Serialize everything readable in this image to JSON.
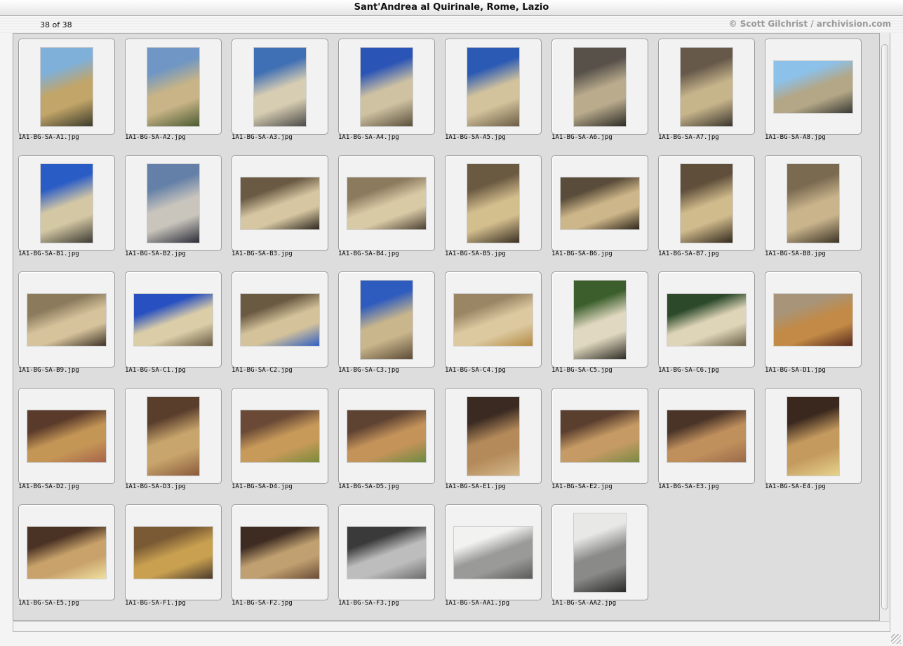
{
  "window": {
    "title": "Sant'Andrea al Quirinale, Rome, Lazio"
  },
  "status": {
    "count": "38 of 38",
    "credit": "© Scott Gilchrist / archivision.com"
  },
  "slides": [
    {
      "file": "1A1-BG-SA-A1.jpg",
      "orientation": "portrait",
      "colors": [
        "#7fb0da",
        "#c2a568",
        "#3b3b2c"
      ]
    },
    {
      "file": "1A1-BG-SA-A2.jpg",
      "orientation": "portrait",
      "colors": [
        "#6f96c4",
        "#c8b486",
        "#4b5a32"
      ]
    },
    {
      "file": "1A1-BG-SA-A3.jpg",
      "orientation": "portrait",
      "colors": [
        "#3f6fb4",
        "#d7cdb2",
        "#4a4a48"
      ]
    },
    {
      "file": "1A1-BG-SA-A4.jpg",
      "orientation": "portrait",
      "colors": [
        "#2a54b6",
        "#cfc2a2",
        "#5a4f3c"
      ]
    },
    {
      "file": "1A1-BG-SA-A5.jpg",
      "orientation": "portrait",
      "colors": [
        "#2b5ab4",
        "#d2c39c",
        "#6b5c44"
      ]
    },
    {
      "file": "1A1-BG-SA-A6.jpg",
      "orientation": "portrait",
      "colors": [
        "#57514a",
        "#b9ab8c",
        "#2d2b26"
      ]
    },
    {
      "file": "1A1-BG-SA-A7.jpg",
      "orientation": "portrait",
      "colors": [
        "#66594a",
        "#c6b48b",
        "#3b352c"
      ]
    },
    {
      "file": "1A1-BG-SA-A8.jpg",
      "orientation": "landscape",
      "colors": [
        "#8cc1ea",
        "#b3a787",
        "#3a3a34"
      ]
    },
    {
      "file": "1A1-BG-SA-B1.jpg",
      "orientation": "portrait",
      "colors": [
        "#2a5cc6",
        "#d4c8a4",
        "#3c3a32"
      ]
    },
    {
      "file": "1A1-BG-SA-B2.jpg",
      "orientation": "portrait",
      "colors": [
        "#6480a8",
        "#c9c5bc",
        "#2a2c38"
      ]
    },
    {
      "file": "1A1-BG-SA-B3.jpg",
      "orientation": "landscape",
      "colors": [
        "#6a5a44",
        "#d6c7a2",
        "#2c261e"
      ]
    },
    {
      "file": "1A1-BG-SA-B4.jpg",
      "orientation": "landscape",
      "colors": [
        "#8c7a5e",
        "#d9caa6",
        "#4b4032"
      ]
    },
    {
      "file": "1A1-BG-SA-B5.jpg",
      "orientation": "portrait",
      "colors": [
        "#6b5a42",
        "#d3be8e",
        "#3a3024"
      ]
    },
    {
      "file": "1A1-BG-SA-B6.jpg",
      "orientation": "landscape",
      "colors": [
        "#5a4c3a",
        "#cdb689",
        "#2e261c"
      ]
    },
    {
      "file": "1A1-BG-SA-B7.jpg",
      "orientation": "portrait",
      "colors": [
        "#5e4e3a",
        "#d0bb8c",
        "#33291e"
      ]
    },
    {
      "file": "1A1-BG-SA-B8.jpg",
      "orientation": "portrait",
      "colors": [
        "#7a6a50",
        "#c9b48c",
        "#3d3426"
      ]
    },
    {
      "file": "1A1-BG-SA-B9.jpg",
      "orientation": "landscape",
      "colors": [
        "#8b7a5c",
        "#d6c39c",
        "#3d3327"
      ]
    },
    {
      "file": "1A1-BG-SA-C1.jpg",
      "orientation": "landscape",
      "colors": [
        "#2850c0",
        "#dacda8",
        "#6a5c44"
      ]
    },
    {
      "file": "1A1-BG-SA-C2.jpg",
      "orientation": "landscape",
      "colors": [
        "#6a5a42",
        "#d4c29a",
        "#2f5fc2"
      ]
    },
    {
      "file": "1A1-BG-SA-C3.jpg",
      "orientation": "portrait",
      "colors": [
        "#2e5cbe",
        "#c9b68c",
        "#5c4c36"
      ]
    },
    {
      "file": "1A1-BG-SA-C4.jpg",
      "orientation": "landscape",
      "colors": [
        "#9a8664",
        "#dcc9a0",
        "#b48a44"
      ]
    },
    {
      "file": "1A1-BG-SA-C5.jpg",
      "orientation": "portrait",
      "colors": [
        "#3b5e2c",
        "#e0d8c0",
        "#2e2c24"
      ]
    },
    {
      "file": "1A1-BG-SA-C6.jpg",
      "orientation": "landscape",
      "colors": [
        "#2c4a2a",
        "#ded4b8",
        "#6a6048"
      ]
    },
    {
      "file": "1A1-BG-SA-D1.jpg",
      "orientation": "landscape",
      "colors": [
        "#a89478",
        "#c28a46",
        "#5a2a1e"
      ]
    },
    {
      "file": "1A1-BG-SA-D2.jpg",
      "orientation": "landscape",
      "colors": [
        "#5a3a2a",
        "#c49656",
        "#a8644a"
      ]
    },
    {
      "file": "1A1-BG-SA-D3.jpg",
      "orientation": "portrait",
      "colors": [
        "#5a3e2c",
        "#c8a56c",
        "#8a5a3c"
      ]
    },
    {
      "file": "1A1-BG-SA-D4.jpg",
      "orientation": "landscape",
      "colors": [
        "#6a4a36",
        "#c89a5a",
        "#7a8a3a"
      ]
    },
    {
      "file": "1A1-BG-SA-D5.jpg",
      "orientation": "landscape",
      "colors": [
        "#5e4232",
        "#c4935a",
        "#6c8a40"
      ]
    },
    {
      "file": "1A1-BG-SA-E1.jpg",
      "orientation": "portrait",
      "colors": [
        "#3a2a22",
        "#b48a5a",
        "#d4b88a"
      ]
    },
    {
      "file": "1A1-BG-SA-E2.jpg",
      "orientation": "landscape",
      "colors": [
        "#5a3e2e",
        "#c59a64",
        "#7a8a44"
      ]
    },
    {
      "file": "1A1-BG-SA-E3.jpg",
      "orientation": "landscape",
      "colors": [
        "#4a3428",
        "#bf8f5c",
        "#9a6a4a"
      ]
    },
    {
      "file": "1A1-BG-SA-E4.jpg",
      "orientation": "portrait",
      "colors": [
        "#3a281e",
        "#c49a5e",
        "#e6d38c"
      ]
    },
    {
      "file": "1A1-BG-SA-E5.jpg",
      "orientation": "landscape",
      "colors": [
        "#4a3224",
        "#c8a26a",
        "#f0e0a0"
      ]
    },
    {
      "file": "1A1-BG-SA-F1.jpg",
      "orientation": "landscape",
      "colors": [
        "#7a5a34",
        "#c8a050",
        "#4a3a2c"
      ]
    },
    {
      "file": "1A1-BG-SA-F2.jpg",
      "orientation": "landscape",
      "colors": [
        "#3e2c22",
        "#c0a070",
        "#6a4c36"
      ]
    },
    {
      "file": "1A1-BG-SA-F3.jpg",
      "orientation": "landscape",
      "colors": [
        "#3a3a3a",
        "#bdbdbd",
        "#6c6c6c"
      ]
    },
    {
      "file": "1A1-BG-SA-AA1.jpg",
      "orientation": "landscape",
      "colors": [
        "#f2f2f0",
        "#9a9a98",
        "#5a5a58"
      ]
    },
    {
      "file": "1A1-BG-SA-AA2.jpg",
      "orientation": "portrait",
      "colors": [
        "#e8e8e6",
        "#8a8a88",
        "#2a2a28"
      ]
    }
  ]
}
